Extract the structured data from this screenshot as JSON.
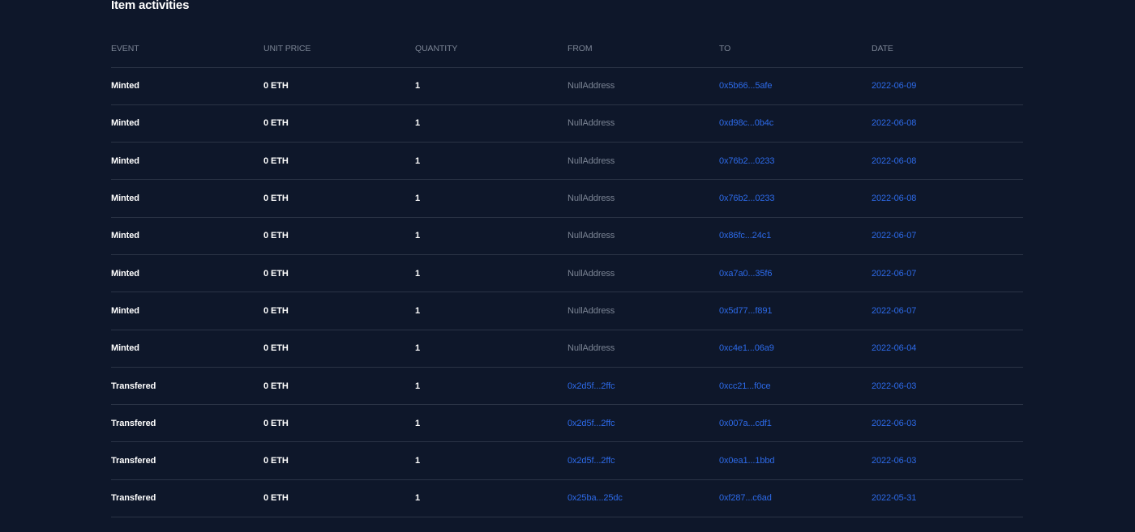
{
  "section": {
    "title": "Item activities"
  },
  "table": {
    "columns": [
      "EVENT",
      "UNIT PRICE",
      "QUANTITY",
      "FROM",
      "TO",
      "DATE"
    ],
    "rows": [
      {
        "event": "Minted",
        "price": "0 ETH",
        "qty": "1",
        "from": "NullAddress",
        "from_link": false,
        "to": "0x5b66...5afe",
        "date": "2022-06-09"
      },
      {
        "event": "Minted",
        "price": "0 ETH",
        "qty": "1",
        "from": "NullAddress",
        "from_link": false,
        "to": "0xd98c...0b4c",
        "date": "2022-06-08"
      },
      {
        "event": "Minted",
        "price": "0 ETH",
        "qty": "1",
        "from": "NullAddress",
        "from_link": false,
        "to": "0x76b2...0233",
        "date": "2022-06-08"
      },
      {
        "event": "Minted",
        "price": "0 ETH",
        "qty": "1",
        "from": "NullAddress",
        "from_link": false,
        "to": "0x76b2...0233",
        "date": "2022-06-08"
      },
      {
        "event": "Minted",
        "price": "0 ETH",
        "qty": "1",
        "from": "NullAddress",
        "from_link": false,
        "to": "0x86fc...24c1",
        "date": "2022-06-07"
      },
      {
        "event": "Minted",
        "price": "0 ETH",
        "qty": "1",
        "from": "NullAddress",
        "from_link": false,
        "to": "0xa7a0...35f6",
        "date": "2022-06-07"
      },
      {
        "event": "Minted",
        "price": "0 ETH",
        "qty": "1",
        "from": "NullAddress",
        "from_link": false,
        "to": "0x5d77...f891",
        "date": "2022-06-07"
      },
      {
        "event": "Minted",
        "price": "0 ETH",
        "qty": "1",
        "from": "NullAddress",
        "from_link": false,
        "to": "0xc4e1...06a9",
        "date": "2022-06-04"
      },
      {
        "event": "Transfered",
        "price": "0 ETH",
        "qty": "1",
        "from": "0x2d5f...2ffc",
        "from_link": true,
        "to": "0xcc21...f0ce",
        "date": "2022-06-03"
      },
      {
        "event": "Transfered",
        "price": "0 ETH",
        "qty": "1",
        "from": "0x2d5f...2ffc",
        "from_link": true,
        "to": "0x007a...cdf1",
        "date": "2022-06-03"
      },
      {
        "event": "Transfered",
        "price": "0 ETH",
        "qty": "1",
        "from": "0x2d5f...2ffc",
        "from_link": true,
        "to": "0x0ea1...1bbd",
        "date": "2022-06-03"
      },
      {
        "event": "Transfered",
        "price": "0 ETH",
        "qty": "1",
        "from": "0x25ba...25dc",
        "from_link": true,
        "to": "0xf287...c6ad",
        "date": "2022-05-31"
      }
    ]
  },
  "colors": {
    "background": "#0e172a",
    "link": "#2d6ae8",
    "muted": "#7b8494",
    "divider": "#2b3446"
  }
}
